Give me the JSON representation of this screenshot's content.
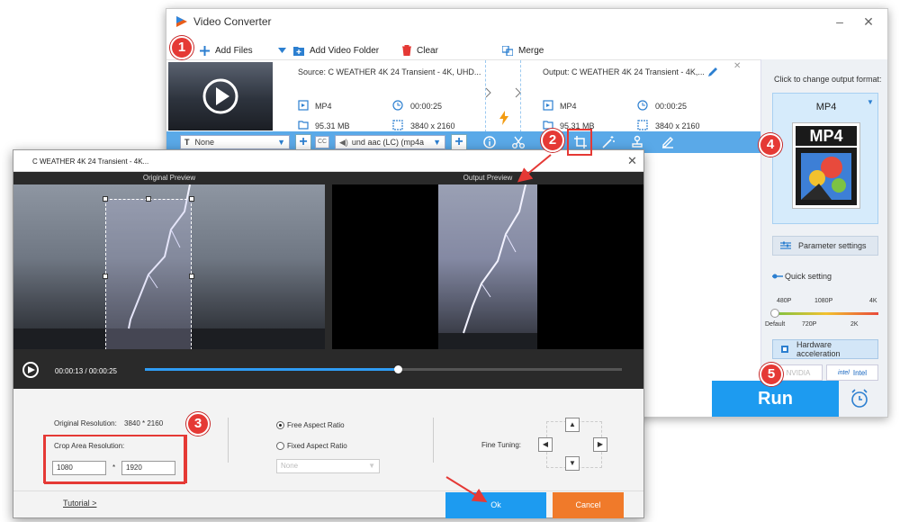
{
  "app": {
    "title": "Video Converter"
  },
  "toolbar": {
    "add_files": "Add Files",
    "add_folder": "Add Video Folder",
    "clear": "Clear",
    "merge": "Merge"
  },
  "file": {
    "source": "Source: C  WEATHER  4K 24  Transient - 4K, UHD...",
    "output": "Output: C  WEATHER  4K 24  Transient - 4K,...",
    "src_format": "MP4",
    "src_duration": "00:00:25",
    "src_size": "95.31 MB",
    "src_resolution": "3840 x 2160",
    "out_format": "MP4",
    "out_duration": "00:00:25",
    "out_size": "95.31 MB",
    "out_resolution": "3840 x 2160"
  },
  "edit_bar": {
    "subtitle": "None",
    "audio": "und aac (LC) (mp4a"
  },
  "right_panel": {
    "hint": "Click to change output format:",
    "format": "MP4",
    "format_icon_text": "MP4",
    "param_settings": "Parameter settings",
    "quick_setting": "Quick setting",
    "scale_top": [
      "480P",
      "1080P",
      "4K"
    ],
    "scale_bottom": [
      "Default",
      "720P",
      "2K"
    ],
    "hw_accel": "Hardware acceleration",
    "nvidia": "NVIDIA",
    "intel": "Intel"
  },
  "run": {
    "label": "Run"
  },
  "crop": {
    "title": "C  WEATHER  4K 24  Transient - 4K...",
    "original_preview": "Original Preview",
    "output_preview": "Output Preview",
    "current_time": "00:00:13",
    "separator": "/",
    "total_time": "00:00:25",
    "progress": 0.53,
    "original_res_label": "Original Resolution:",
    "original_res_value": "3840 * 2160",
    "crop_area_label": "Crop Area Resolution:",
    "width": "1080",
    "star": "*",
    "height": "1920",
    "free_ratio": "Free Aspect Ratio",
    "fixed_ratio": "Fixed Aspect Ratio",
    "ratio_select": "None",
    "fine_tuning": "Fine Tuning:",
    "tutorial": "Tutorial >",
    "ok": "Ok",
    "cancel": "Cancel"
  },
  "badges": [
    "1",
    "2",
    "3",
    "4",
    "5"
  ],
  "colors": {
    "accent": "#1d9bf0",
    "callout": "#e53935",
    "cancel": "#f07a2a",
    "edit_bar": "#5aa9e8"
  }
}
